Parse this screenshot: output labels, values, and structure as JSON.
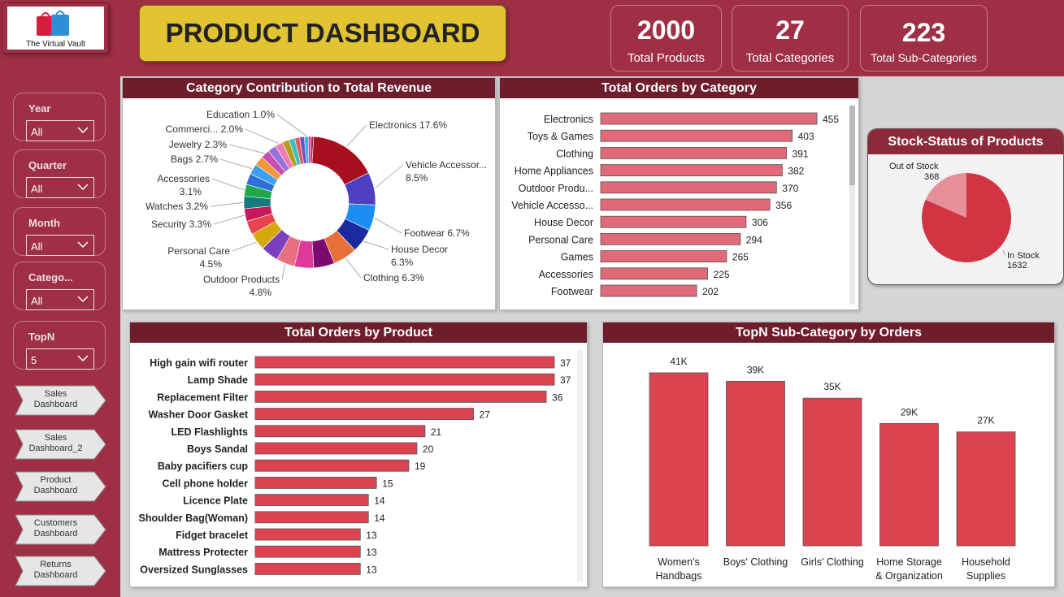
{
  "logo": {
    "text": "The Virtual Vault"
  },
  "title": "PRODUCT DASHBOARD",
  "kpis": [
    {
      "value": "2000",
      "label": "Total Products"
    },
    {
      "value": "27",
      "label": "Total Categories"
    },
    {
      "value": "223",
      "label": "Total Sub-Categories"
    }
  ],
  "slicers": [
    {
      "title": "Year",
      "value": "All"
    },
    {
      "title": "Quarter",
      "value": "All"
    },
    {
      "title": "Month",
      "value": "All"
    },
    {
      "title": "Catego...",
      "value": "All"
    },
    {
      "title": "TopN",
      "value": "5"
    }
  ],
  "nav": [
    {
      "line1": "Sales",
      "line2": "Dashboard"
    },
    {
      "line1": "Sales",
      "line2": "Dashboard_2"
    },
    {
      "line1": "Product",
      "line2": "Dashboard"
    },
    {
      "line1": "Customers",
      "line2": "Dashboard"
    },
    {
      "line1": "Returns",
      "line2": "Dashboard"
    }
  ],
  "colors": {
    "bar": "#e06a77",
    "bar_dark": "#dc4351",
    "stock_in": "#d13543",
    "stock_out": "#e8909a"
  },
  "chart_data": [
    {
      "type": "pie",
      "title": "Category Contribution to Total Revenue",
      "donut": true,
      "labeled_slices": [
        {
          "label": "Electronics",
          "pct": "17.6%",
          "value": 17.6,
          "color": "#a50f1e"
        },
        {
          "label": "Vehicle Accessor...",
          "pct": "8.5%",
          "value": 8.5,
          "color": "#4d3fbf"
        },
        {
          "label": "Footwear",
          "pct": "6.7%",
          "value": 6.7,
          "color": "#1a8ef2"
        },
        {
          "label": "House Decor",
          "pct": "6.3%",
          "value": 6.3,
          "color": "#1b2a9e"
        },
        {
          "label": "Clothing",
          "pct": "6.3%",
          "value": 6.3,
          "color": "#e8703a"
        },
        {
          "label": "",
          "pct": "",
          "value": 5.4,
          "color": "#7a0a6e"
        },
        {
          "label": "",
          "pct": "",
          "value": 5.0,
          "color": "#e0399a"
        },
        {
          "label": "Outdoor Products",
          "pct": "4.8%",
          "value": 4.8,
          "color": "#e8707e"
        },
        {
          "label": "",
          "pct": "",
          "value": 4.6,
          "color": "#7a3fbf"
        },
        {
          "label": "Personal Care",
          "pct": "4.5%",
          "value": 4.5,
          "color": "#d6a80a"
        },
        {
          "label": "",
          "pct": "",
          "value": 3.6,
          "color": "#e8434f"
        },
        {
          "label": "Security",
          "pct": "3.3%",
          "value": 3.3,
          "color": "#c8175a"
        },
        {
          "label": "Watches",
          "pct": "3.2%",
          "value": 3.2,
          "color": "#157a7e"
        },
        {
          "label": "Accessories",
          "pct": "3.1%",
          "value": 3.1,
          "color": "#1fa84a"
        },
        {
          "label": "",
          "pct": "",
          "value": 2.9,
          "color": "#2e6fd9"
        },
        {
          "label": "Bags",
          "pct": "2.7%",
          "value": 2.7,
          "color": "#3aa0f2"
        },
        {
          "label": "",
          "pct": "",
          "value": 2.5,
          "color": "#f2973a"
        },
        {
          "label": "Jewelry",
          "pct": "2.3%",
          "value": 2.3,
          "color": "#c84fb0"
        },
        {
          "label": "",
          "pct": "",
          "value": 2.2,
          "color": "#9a6fe0"
        },
        {
          "label": "Commerci...",
          "pct": "2.0%",
          "value": 2.0,
          "color": "#f27ab0"
        },
        {
          "label": "",
          "pct": "",
          "value": 1.8,
          "color": "#b0a020"
        },
        {
          "label": "",
          "pct": "",
          "value": 1.5,
          "color": "#3ac0c0"
        },
        {
          "label": "",
          "pct": "",
          "value": 1.3,
          "color": "#e05a5a"
        },
        {
          "label": "",
          "pct": "",
          "value": 1.2,
          "color": "#6a4fc0"
        },
        {
          "label": "Education",
          "pct": "1.0%",
          "value": 1.0,
          "color": "#3ab0e0"
        },
        {
          "label": "",
          "pct": "",
          "value": 0.8,
          "color": "#e0439a"
        },
        {
          "label": "",
          "pct": "",
          "value": 0.6,
          "color": "#a01e3a"
        }
      ]
    },
    {
      "type": "bar",
      "orientation": "horizontal",
      "title": "Total Orders by Category",
      "categories": [
        "Electronics",
        "Toys & Games",
        "Clothing",
        "Home Appliances",
        "Outdoor Produ...",
        "Vehicle Accesso...",
        "House Decor",
        "Personal Care",
        "Games",
        "Accessories",
        "Footwear"
      ],
      "values": [
        455,
        403,
        391,
        382,
        370,
        356,
        306,
        294,
        265,
        225,
        202
      ],
      "xlim": [
        0,
        455
      ]
    },
    {
      "type": "pie",
      "title": "Stock-Status of Products",
      "slices": [
        {
          "label": "In Stock",
          "value": 1632
        },
        {
          "label": "Out of Stock",
          "value": 368
        }
      ]
    },
    {
      "type": "bar",
      "orientation": "horizontal",
      "title": "Total Orders by Product",
      "categories": [
        "High gain wifi router",
        "Lamp Shade",
        "Replacement Filter",
        "Washer Door Gasket",
        "LED Flashlights",
        "Boys Sandal",
        "Baby pacifiers cup",
        "Cell phone holder",
        "Licence Plate",
        "Shoulder Bag(Woman)",
        "Fidget bracelet",
        "Mattress Protecter",
        "Oversized Sunglasses"
      ],
      "values": [
        37,
        37,
        36,
        27,
        21,
        20,
        19,
        15,
        14,
        14,
        13,
        13,
        13
      ],
      "xlim": [
        0,
        37
      ]
    },
    {
      "type": "bar",
      "orientation": "vertical",
      "title": "TopN Sub-Category by Orders",
      "categories": [
        [
          "Women's",
          "Handbags"
        ],
        [
          "Boys' Clothing"
        ],
        [
          "Girls' Clothing"
        ],
        [
          "Home Storage",
          "& Organization"
        ],
        [
          "Household",
          "Supplies"
        ]
      ],
      "values": [
        41000,
        39000,
        35000,
        29000,
        27000
      ],
      "data_labels": [
        "41K",
        "39K",
        "35K",
        "29K",
        "27K"
      ],
      "ylim": [
        0,
        41000
      ]
    }
  ]
}
